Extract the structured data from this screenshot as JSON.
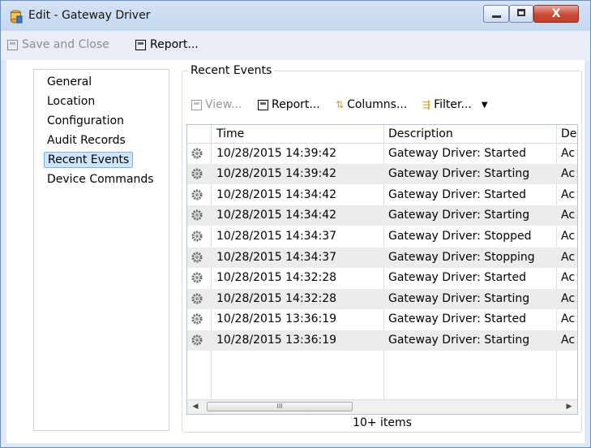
{
  "window": {
    "title": "Edit - Gateway Driver"
  },
  "toolbar": {
    "save_label": "Save and Close",
    "report_label": "Report..."
  },
  "nav": {
    "items": [
      "General",
      "Location",
      "Configuration",
      "Audit Records",
      "Recent Events",
      "Device Commands"
    ],
    "active": "Recent Events"
  },
  "events": {
    "group_label": "Recent Events",
    "toolbar": {
      "view": "View...",
      "report": "Report...",
      "columns": "Columns...",
      "filter": "Filter..."
    },
    "columns": [
      "Time",
      "Description",
      "De"
    ],
    "rows": [
      {
        "time": "10/28/2015 14:39:42",
        "description": "Gateway Driver: Started",
        "extra": "Ac"
      },
      {
        "time": "10/28/2015 14:39:42",
        "description": "Gateway Driver: Starting",
        "extra": "Ac"
      },
      {
        "time": "10/28/2015 14:34:42",
        "description": "Gateway Driver: Started",
        "extra": "Ac"
      },
      {
        "time": "10/28/2015 14:34:42",
        "description": "Gateway Driver: Starting",
        "extra": "Ac"
      },
      {
        "time": "10/28/2015 14:34:37",
        "description": "Gateway Driver: Stopped",
        "extra": "Ac"
      },
      {
        "time": "10/28/2015 14:34:37",
        "description": "Gateway Driver: Stopping",
        "extra": "Ac"
      },
      {
        "time": "10/28/2015 14:32:28",
        "description": "Gateway Driver: Started",
        "extra": "Ac"
      },
      {
        "time": "10/28/2015 14:32:28",
        "description": "Gateway Driver: Starting",
        "extra": "Ac"
      },
      {
        "time": "10/28/2015 13:36:19",
        "description": "Gateway Driver: Started",
        "extra": "Ac"
      },
      {
        "time": "10/28/2015 13:36:19",
        "description": "Gateway Driver: Starting",
        "extra": "Ac"
      }
    ],
    "scroll_thumb_label": "III",
    "count_label": "10+ items"
  }
}
